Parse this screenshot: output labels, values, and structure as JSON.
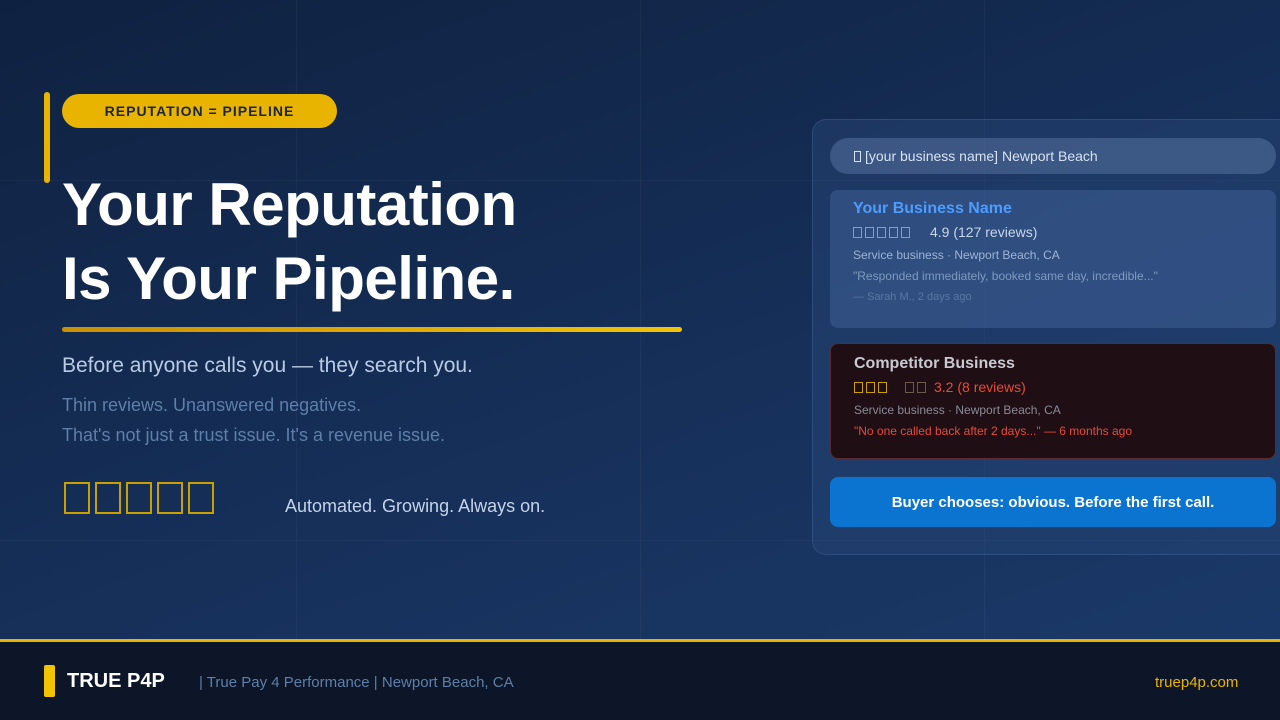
{
  "badge": "REPUTATION = PIPELINE",
  "headline": {
    "line1": "Your Reputation",
    "line2": "Is Your Pipeline."
  },
  "subhead": "Before anyone calls you — they search you.",
  "body": {
    "line1": "Thin reviews. Unanswered negatives.",
    "line2": "That's not just a trust issue. It's a revenue issue."
  },
  "rating_icons": {
    "big_stars": "star-icon",
    "count": 5
  },
  "tagline": "Automated. Growing. Always on.",
  "search": {
    "icon": "search-icon",
    "query": "[your business name] Newport Beach"
  },
  "own_listing": {
    "name": "Your Business Name",
    "rating_text": "4.9 (127 reviews)",
    "stars": 5,
    "meta": "Service business · Newport Beach, CA",
    "quote": "\"Responded immediately, booked same day, incredible...\"",
    "attribution": "— Sarah M., 2 days ago"
  },
  "competitor_listing": {
    "name": "Competitor Business",
    "rating_text": "3.2 (8 reviews)",
    "filled_stars": 3,
    "empty_stars": 2,
    "meta": "Service business · Newport Beach, CA",
    "quote": "\"No one called back after 2 days...\" — 6 months ago"
  },
  "cta": "Buyer chooses: obvious. Before the first call.",
  "footer": {
    "brand": "TRUE P4P",
    "tagline": "| True Pay 4 Performance | Newport Beach, CA",
    "url": "truep4p.com"
  },
  "colors": {
    "accent": "#e8b400",
    "background": "#16305a",
    "link_blue": "#4d9cff",
    "negative_red": "#e84a3a",
    "cta_blue": "#0b74d0"
  }
}
